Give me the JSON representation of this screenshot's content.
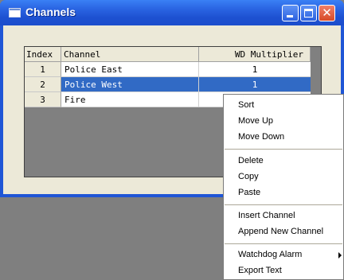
{
  "window": {
    "title": "Channels"
  },
  "grid": {
    "headers": {
      "index": "Index",
      "channel": "Channel",
      "wd_multiplier": "WD Multiplier"
    },
    "rows": [
      {
        "index": "1",
        "channel": "Police East",
        "wd_multiplier": "1"
      },
      {
        "index": "2",
        "channel": "Police West",
        "wd_multiplier": "1",
        "selected": true
      },
      {
        "index": "3",
        "channel": "Fire",
        "wd_multiplier": ""
      }
    ]
  },
  "context_menu": {
    "items": [
      {
        "label": "Sort"
      },
      {
        "label": "Move Up"
      },
      {
        "label": "Move Down"
      },
      {
        "label": "Delete"
      },
      {
        "label": "Copy"
      },
      {
        "label": "Paste"
      },
      {
        "label": "Insert Channel"
      },
      {
        "label": "Append New Channel"
      },
      {
        "label": "Watchdog Alarm",
        "submenu": true
      },
      {
        "label": "Export Text"
      }
    ]
  },
  "colors": {
    "titlebar": "#2a64e2",
    "selection": "#316ac5",
    "client": "#ece9d8",
    "desktop": "#7f7f7f"
  },
  "icons": {
    "app": "window-icon",
    "minimize": "minimize-icon",
    "maximize": "maximize-icon",
    "close": "close-icon",
    "submenu": "chevron-right-icon"
  }
}
